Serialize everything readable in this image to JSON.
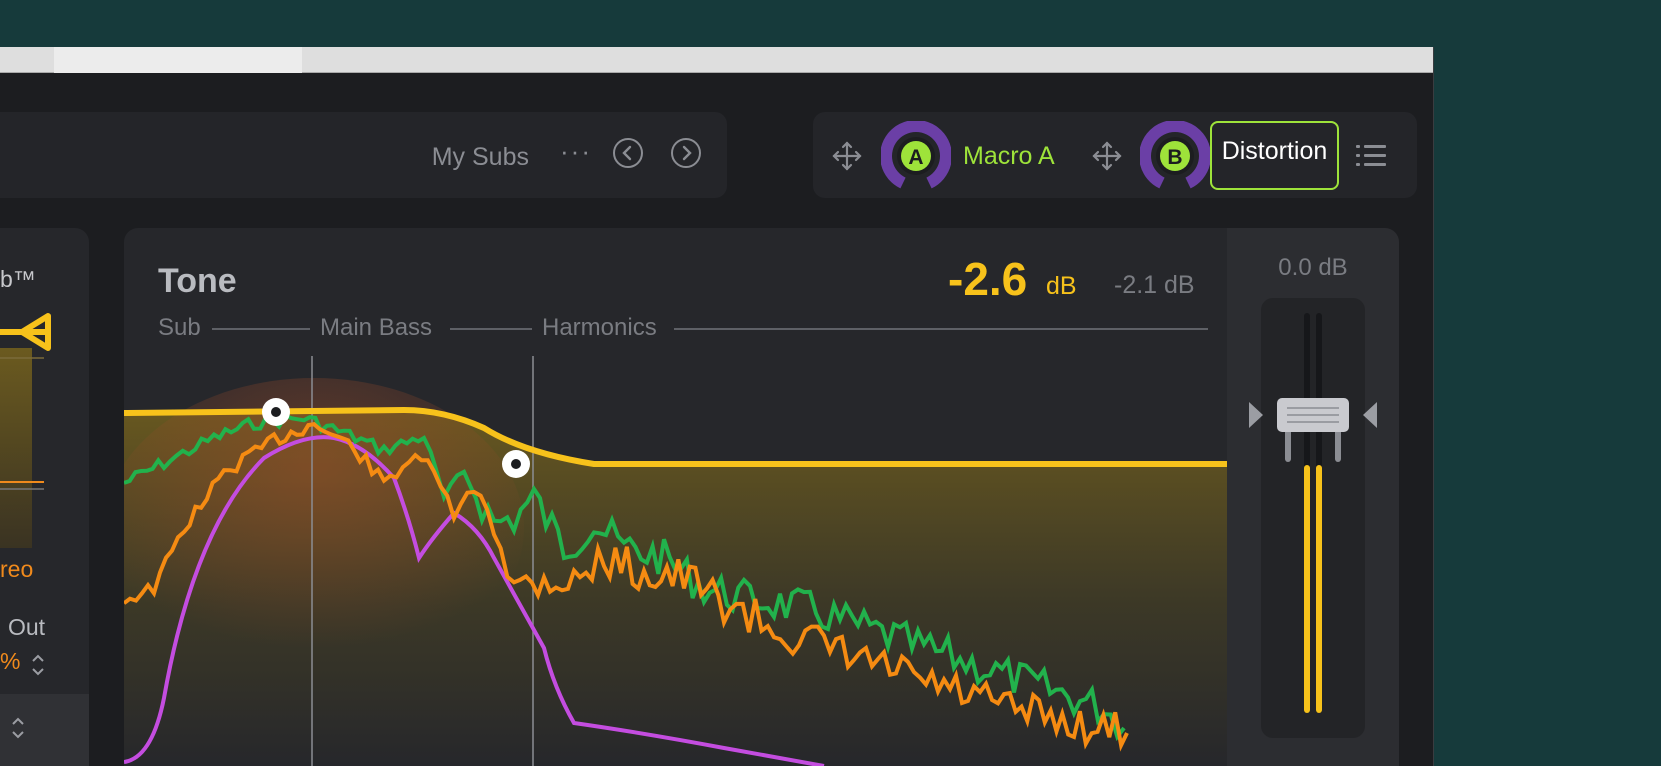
{
  "header": {
    "preset_name": "My Subs",
    "more_icon": "more-dots-icon",
    "prev_icon": "chevron-left-circle-icon",
    "next_icon": "chevron-right-circle-icon"
  },
  "macros": [
    {
      "badge": "A",
      "label": "Macro A",
      "ring_color": "#6b3fa6",
      "badge_color": "#9ee33a"
    },
    {
      "badge": "B",
      "label": "Distortion",
      "ring_color": "#6b3fa6",
      "badge_color": "#9ee33a"
    }
  ],
  "left_panel": {
    "brand": "b™",
    "stereo": "reo",
    "out_label": "Out",
    "percent": "%"
  },
  "tone": {
    "title": "Tone",
    "gain_value": "-2.6",
    "gain_unit": "dB",
    "secondary_gain": "-2.1 dB",
    "bands": [
      "Sub",
      "Main Bass",
      "Harmonics"
    ]
  },
  "meter": {
    "gain": "0.0 dB",
    "level_fraction": 0.62
  },
  "colors": {
    "accent_yellow": "#f7c21b",
    "accent_green": "#9ee33a",
    "curve_green": "#22b24c",
    "curve_orange": "#f58b12",
    "curve_magenta": "#c44de0",
    "background": "#163a3b"
  }
}
